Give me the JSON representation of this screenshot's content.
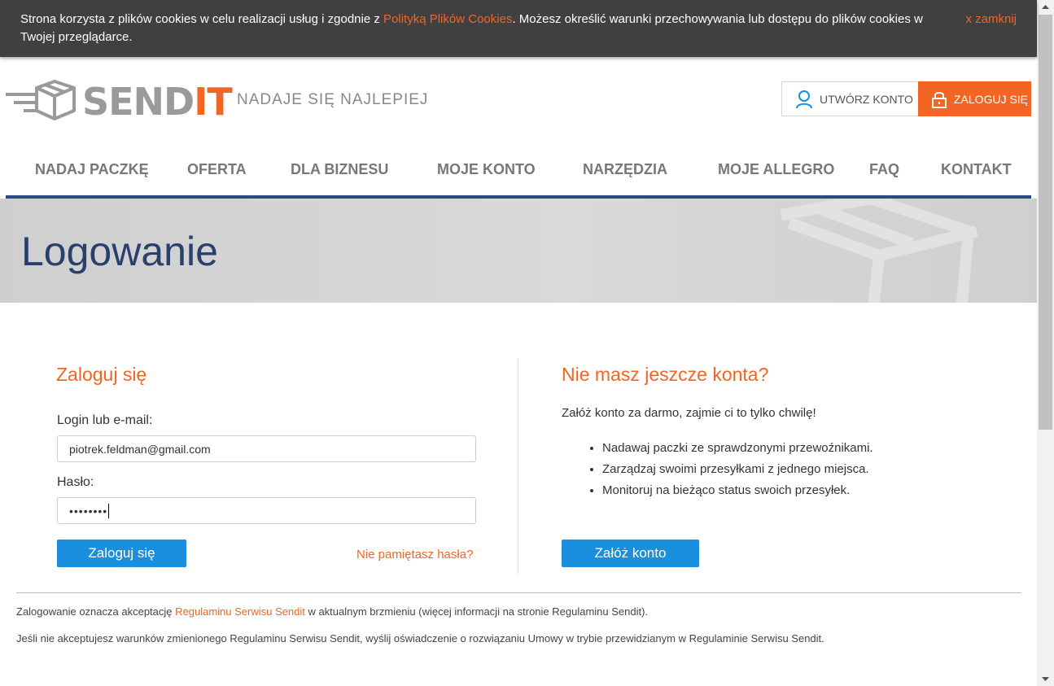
{
  "cookie_bar": {
    "text_before": "Strona korzysta z plików cookies w celu realizacji usług i zgodnie z ",
    "policy_link": "Polityką Plików Cookies",
    "text_after": ". Możesz określić warunki przechowywania lub dostępu do plików cookies w Twojej przeglądarce.",
    "close_label": "x zamknij"
  },
  "header": {
    "logo_part1": "SEND",
    "logo_part2": "IT",
    "tagline": "NADAJE SIĘ NAJLEPIEJ",
    "register_label": "UTWÓRZ KONTO",
    "login_label": "ZALOGUJ SIĘ"
  },
  "nav": {
    "items": [
      "NADAJ PACZKĘ",
      "OFERTA",
      "DLA BIZNESU",
      "MOJE KONTO",
      "NARZĘDZIA",
      "MOJE ALLEGRO",
      "FAQ",
      "KONTAKT"
    ]
  },
  "banner": {
    "title": "Logowanie"
  },
  "login": {
    "title": "Zaloguj się",
    "login_label": "Login lub e-mail:",
    "login_value": "piotrek.feldman@gmail.com",
    "password_label": "Hasło:",
    "password_value": "••••••••",
    "submit_label": "Zaloguj się",
    "forgot_label": "Nie pamiętasz hasła?"
  },
  "register": {
    "title": "Nie masz jeszcze konta?",
    "intro": "Załóż konto za darmo, zajmie ci to tylko chwilę!",
    "benefits": [
      "Nadawaj paczki ze sprawdzonymi przewoźnikami.",
      "Zarządzaj swoimi przesyłkami z jednego miejsca.",
      "Monitoruj na bieżąco status swoich przesyłek."
    ],
    "button_label": "Załóż konto"
  },
  "footer": {
    "line1_before": "Zalogowanie oznacza akceptację ",
    "line1_link": "Regulaminu Serwisu Sendit",
    "line1_after": " w aktualnym brzmieniu (więcej informacji na stronie Regulaminu Sendit).",
    "line2": "Jeśli nie akceptujesz warunków zmienionego Regulaminu Serwisu Sendit, wyślij oświadczenie o rozwiązaniu Umowy w trybie przewidzianym w Regulaminie Serwisu Sendit."
  },
  "colors": {
    "accent": "#f26522",
    "primary": "#1a8fdd",
    "navy": "#2a4a80"
  },
  "icons": {
    "register": "user-icon",
    "login": "lock-icon",
    "logo": "package-box-icon"
  }
}
